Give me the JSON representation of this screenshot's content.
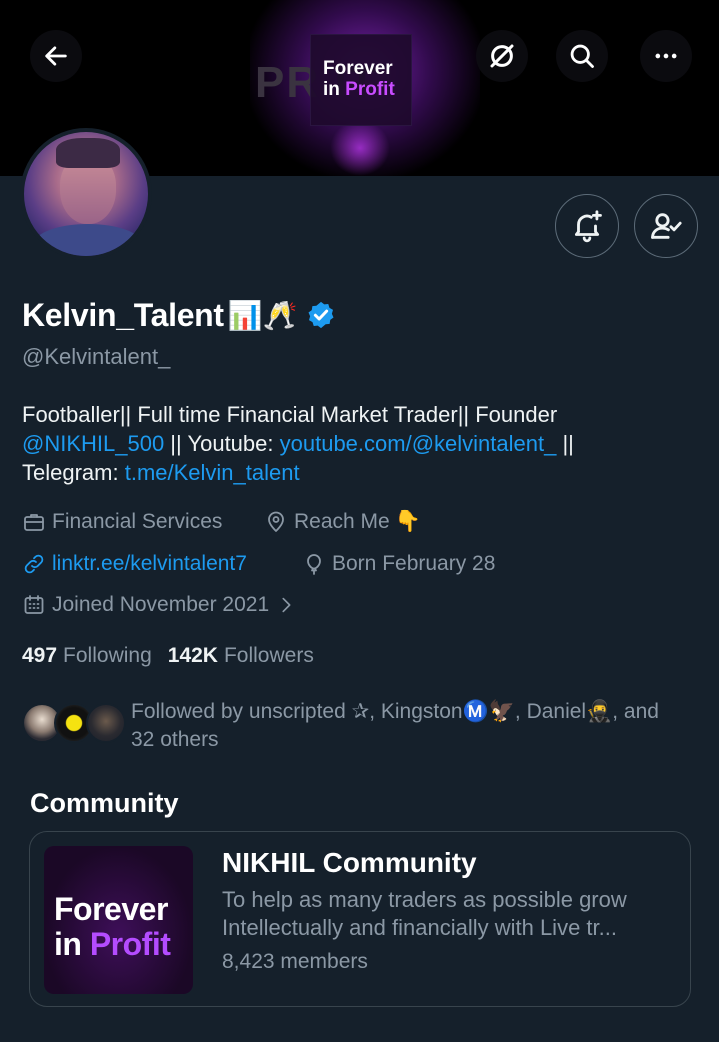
{
  "banner": {
    "big_text": "PR   IT",
    "logo_line1": "Forever",
    "logo_line2_a": "in ",
    "logo_line2_b": "Profit"
  },
  "top_bar": {
    "back_icon": "arrow-left-icon",
    "grok_icon": "slash-circle-icon",
    "search_icon": "search-icon",
    "more_icon": "more-icon"
  },
  "profile": {
    "name": "Kelvin_Talent",
    "name_emojis": "📊🥂",
    "handle": "@Kelvintalent_",
    "bio": {
      "line1": "Footballer|| Full time Financial Market Trader|| Founder",
      "mention": "@NIKHIL_500",
      "text2": " || Youtube: ",
      "youtube_link": "youtube.com/@kelvintalent_",
      "text3": " ||",
      "telegram_label": "Telegram: ",
      "telegram_link": "t.me/Kelvin_talent"
    },
    "category": "Financial Services",
    "location": "Reach Me",
    "location_emoji": "👇",
    "website": "linktr.ee/kelvintalent7",
    "birthday": "Born February 28",
    "joined": "Joined November 2021",
    "following_count": "497",
    "following_label": "Following",
    "followers_count": "142K",
    "followers_label": "Followers",
    "followed_by_line1": "Followed by unscripted ✰, KingstonⓂ️🦅, Daniel🥷, and",
    "followed_by_line2": "32 others"
  },
  "community": {
    "section_title": "Community",
    "logo_line1": "Forever",
    "logo_line2_a": "in ",
    "logo_line2_b": "Profit",
    "name": "NIKHIL Community",
    "desc_line1": "To help as many traders as possible grow",
    "desc_line2": "Intellectually and financially with Live tr...",
    "members": "8,423 members"
  },
  "colors": {
    "background": "#15202b",
    "accent": "#1d9bf0",
    "muted": "#8b98a5",
    "brand_purple": "#c84cff"
  }
}
